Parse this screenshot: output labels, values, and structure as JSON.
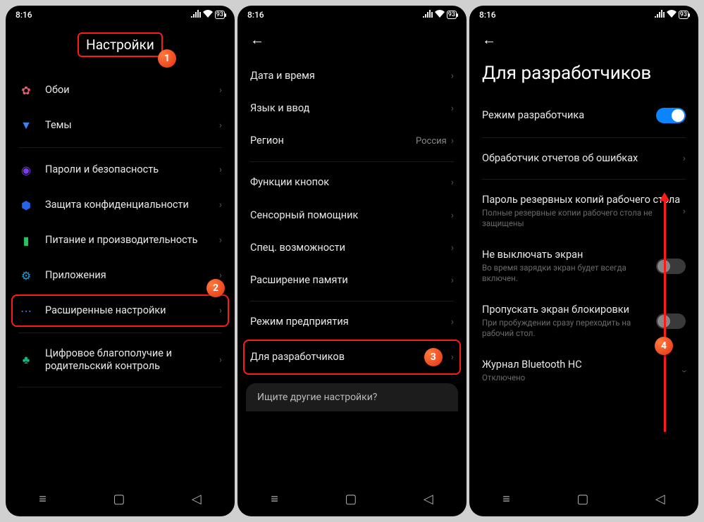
{
  "status": {
    "time": "8:16",
    "battery": "93"
  },
  "screen1": {
    "title": "Настройки",
    "items": [
      {
        "label": "Обои"
      },
      {
        "label": "Темы"
      },
      {
        "label": "Пароли и безопасность"
      },
      {
        "label": "Защита конфиденциальности"
      },
      {
        "label": "Питание и производительность"
      },
      {
        "label": "Приложения"
      },
      {
        "label": "Расширенные настройки"
      },
      {
        "label": "Цифровое благополучие и родительский контроль"
      }
    ]
  },
  "screen2": {
    "items": [
      {
        "label": "Дата и время"
      },
      {
        "label": "Язык и ввод"
      },
      {
        "label": "Регион",
        "value": "Россия"
      },
      {
        "label": "Функции кнопок"
      },
      {
        "label": "Сенсорный помощник"
      },
      {
        "label": "Спец. возможности"
      },
      {
        "label": "Расширение памяти"
      },
      {
        "label": "Режим предприятия"
      },
      {
        "label": "Для разработчиков"
      }
    ],
    "search_hint": "Ищите другие настройки?"
  },
  "screen3": {
    "title": "Для разработчиков",
    "items": [
      {
        "label": "Режим разработчика",
        "toggle": "on"
      },
      {
        "label": "Обработчик отчетов об ошибках"
      },
      {
        "label": "Пароль резервных копий рабочего стола",
        "sub": "Полные резервные копии рабочего стола не защищены"
      },
      {
        "label": "Не выключать экран",
        "sub": "Во время зарядки экран будет всегда включен.",
        "toggle": "off"
      },
      {
        "label": "Пропускать экран блокировки",
        "sub": "При пробуждении сразу переходить на рабочий стол.",
        "toggle": "off"
      },
      {
        "label": "Журнал Bluetooth HC",
        "sub": "Отключено"
      }
    ]
  },
  "badges": {
    "b1": "1",
    "b2": "2",
    "b3": "3",
    "b4": "4"
  }
}
